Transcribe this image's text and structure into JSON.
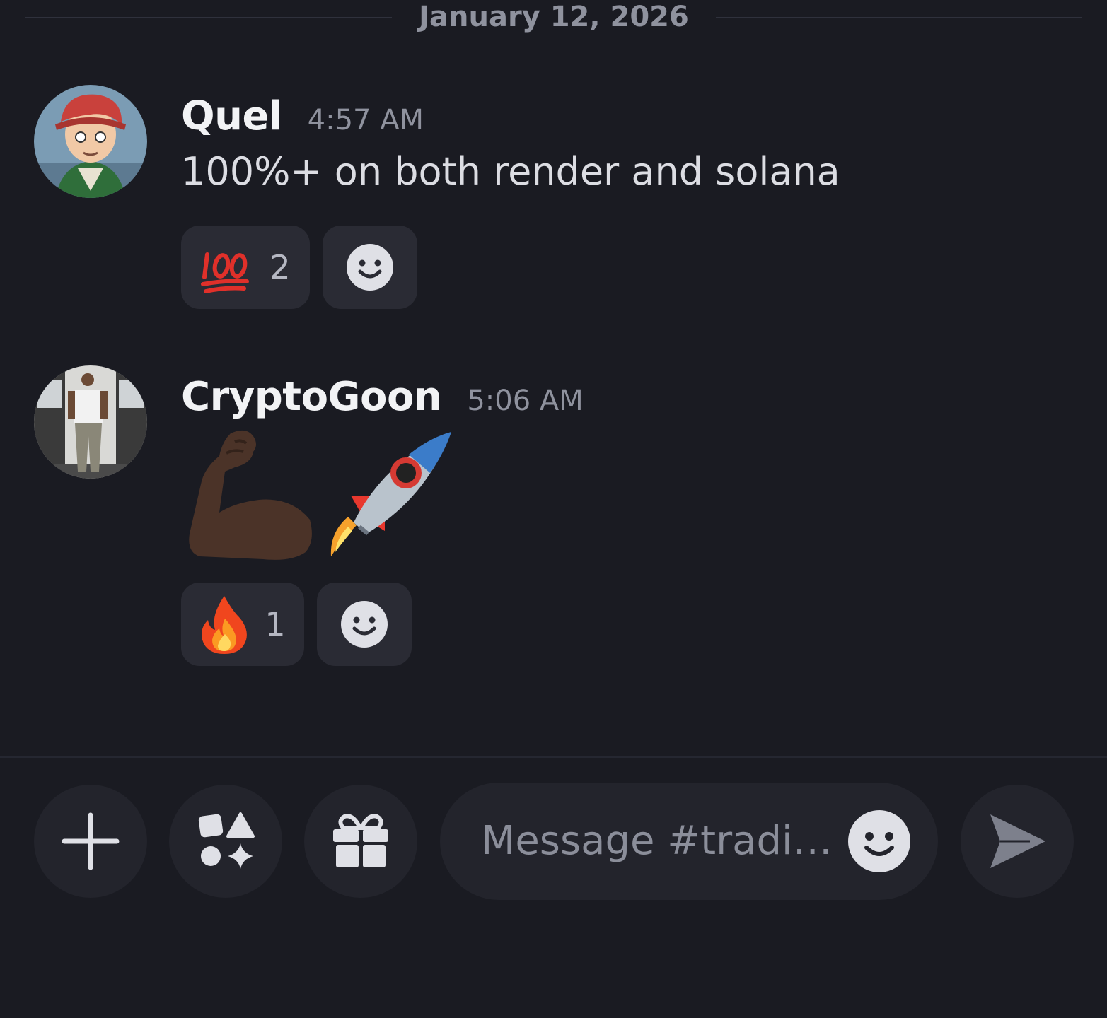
{
  "divider": {
    "date": "January 12, 2026"
  },
  "messages": [
    {
      "username": "Quel",
      "time": "4:57 AM",
      "text": "100%+ on both render and solana",
      "reactions": [
        {
          "emoji": "hundred-points",
          "count": "2"
        }
      ]
    },
    {
      "username": "CryptoGoon",
      "time": "5:06 AM",
      "emojis": [
        "flexed-biceps",
        "rocket"
      ],
      "reactions": [
        {
          "emoji": "fire",
          "count": "1"
        }
      ]
    }
  ],
  "composer": {
    "placeholder": "Message #tradin…",
    "buttons": [
      "plus-icon",
      "apps-icon",
      "gift-icon",
      "emoji-icon",
      "send-icon"
    ]
  },
  "colors": {
    "background": "#1a1b22",
    "surface": "#23242c",
    "reaction": "#2a2b34",
    "muted_text": "#8f929e"
  }
}
